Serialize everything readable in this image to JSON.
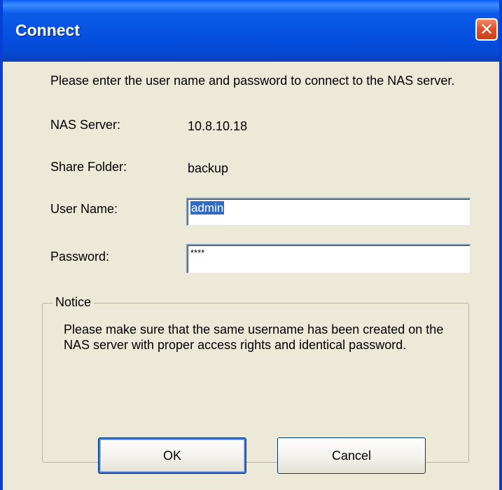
{
  "window": {
    "title": "Connect",
    "close_glyph": "✕"
  },
  "intro": {
    "text": "Please enter the user name and password to connect to the NAS server."
  },
  "nas_server": {
    "label": "NAS Server:",
    "value": "10.8.10.18"
  },
  "share_folder": {
    "label": "Share Folder:",
    "value": "backup"
  },
  "user_name": {
    "label": "User Name:",
    "value": "admin"
  },
  "password": {
    "label": "Password:",
    "value": "****"
  },
  "notice": {
    "legend": "Notice",
    "text": "Please make sure that the same username has been created on the NAS server with proper access rights and identical password."
  },
  "buttons": {
    "ok": "OK",
    "cancel": "Cancel"
  },
  "colors": {
    "titlebar": "#0550e0",
    "dialog_bg": "#ece9d8",
    "close_button": "#e0532c",
    "selection": "#316ac5"
  }
}
